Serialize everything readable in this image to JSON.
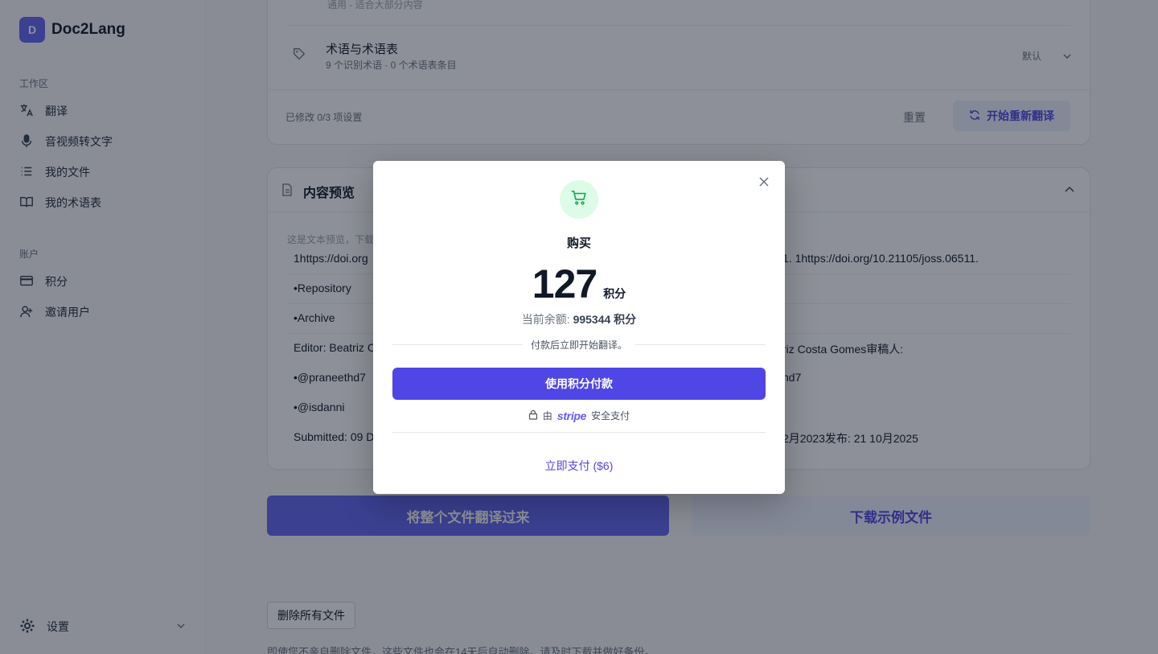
{
  "brand": {
    "logo_letter": "D",
    "name": "Doc2Lang",
    "accent": "#6366f1"
  },
  "sidebar": {
    "workspace_label": "工作区",
    "workspace_items": [
      {
        "label": "翻译",
        "icon": "translate-icon"
      },
      {
        "label": "音视频转文字",
        "icon": "microphone-icon"
      },
      {
        "label": "我的文件",
        "icon": "list-icon"
      },
      {
        "label": "我的术语表",
        "icon": "book-icon"
      }
    ],
    "account_label": "账户",
    "account_items": [
      {
        "label": "积分",
        "icon": "credit-card-icon"
      },
      {
        "label": "邀请用户",
        "icon": "user-plus-icon"
      }
    ],
    "settings_label": "设置"
  },
  "settings_card": {
    "top_cut_text": "通用 - 适合大部分内容",
    "glossary_title": "术语与术语表",
    "glossary_sub": "9 个识别术语 · 0 个术语表条目",
    "glossary_value": "默认",
    "modified_text": "已修改 0/3 项设置",
    "reset_label": "重置",
    "retranslate_label": "开始重新翻译"
  },
  "preview": {
    "title": "内容预览",
    "notice": "这是文本预览，下载",
    "left_lines": [
      "1https://doi.org",
      "•Repository",
      "•Archive",
      "Editor: Beatriz C",
      "•@praneethd7",
      "•@isdanni",
      "Submitted: 09 D"
    ],
    "right_lines": [
      "1. 1https://doi.org/10.21105/joss.06511.",
      "",
      "",
      "riz Costa Gomes审稿人:",
      "hd7",
      "",
      "2月2023发布:  21 10月2025"
    ]
  },
  "actions": {
    "translate_all": "将整个文件翻译过来",
    "download_sample": "下载示例文件",
    "delete_all": "删除所有文件",
    "footnote": "即使您不亲自删除文件，这些文件也会在14天后自动删除。请及时下载并做好备份。"
  },
  "modal": {
    "title": "购买",
    "amount": "127",
    "amount_unit": "积分",
    "balance_label": "当前余额:",
    "balance_value": "995344 积分",
    "divider_note": "付款后立即开始翻译。",
    "pay_credits_label": "使用积分付款",
    "secure_prefix": "由",
    "secure_brand": "stripe",
    "secure_suffix": "安全支付",
    "pay_now_label": "立即支付 ($6)",
    "accent": "#4f46e5",
    "cart_bg": "#dcfce7"
  }
}
